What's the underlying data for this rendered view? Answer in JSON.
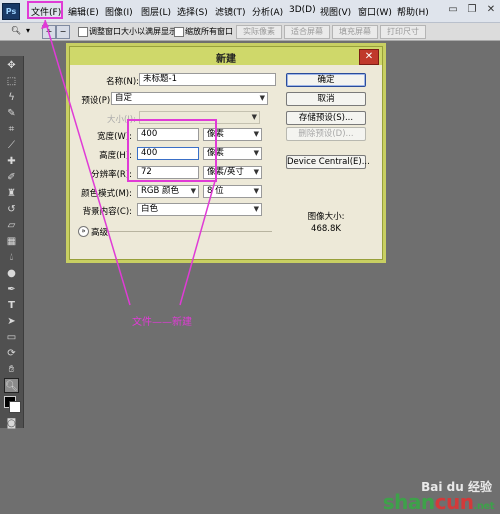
{
  "app": {
    "logo_text": "Ps"
  },
  "menubar": {
    "items": [
      "文件(F)",
      "编辑(E)",
      "图像(I)",
      "图层(L)",
      "选择(S)",
      "滤镜(T)",
      "分析(A)",
      "3D(D)",
      "视图(V)",
      "窗口(W)",
      "帮助(H)"
    ]
  },
  "options_bar": {
    "check_fit_label": "调整窗口大小以满屏显示",
    "check_zoom_all_label": "缩放所有窗口",
    "actual_pixels": "实际像素",
    "fit_screen": "适合屏幕",
    "fill_screen": "填充屏幕",
    "print_size": "打印尺寸"
  },
  "dialog": {
    "title": "新建",
    "name_label": "名称(N):",
    "name_value": "未标题-1",
    "preset_label": "预设(P):",
    "preset_value": "自定",
    "size_label": "大小(I):",
    "width_label": "宽度(W):",
    "width_value": "400",
    "width_unit": "像素",
    "height_label": "高度(H):",
    "height_value": "400",
    "height_unit": "像素",
    "resolution_label": "分辨率(R):",
    "resolution_value": "72",
    "resolution_unit": "像素/英寸",
    "color_mode_label": "颜色模式(M):",
    "color_mode_value": "RGB 颜色",
    "bit_depth_value": "8 位",
    "bg_label": "背景内容(C):",
    "bg_value": "白色",
    "advanced_label": "高级",
    "ok": "确定",
    "cancel": "取消",
    "save_preset": "存储预设(S)...",
    "delete_preset": "删除预设(D)...",
    "device_central": "Device Central(E)...",
    "image_size_label": "图像大小:",
    "image_size_value": "468.8K"
  },
  "annotation": {
    "text": "文件——新建"
  },
  "watermark": {
    "text": "Bai du 经验",
    "brand_green": "shan",
    "brand_red": "cun",
    "brand_tail": ".net"
  }
}
